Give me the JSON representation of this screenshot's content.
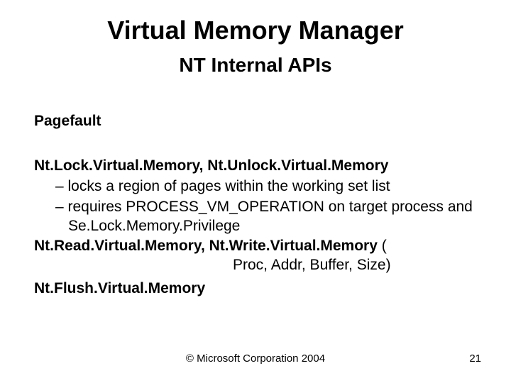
{
  "title": "Virtual Memory Manager",
  "subtitle": "NT Internal APIs",
  "section1": "Pagefault",
  "section2_head": "Nt.Lock.Virtual.Memory, Nt.Unlock.Virtual.Memory",
  "bullet1": "– locks a region of pages within the working set list",
  "bullet2": "– requires PROCESS_VM_OPERATION on target process and Se.Lock.Memory.Privilege",
  "section3_bold": "Nt.Read.Virtual.Memory, Nt.Write.Virtual.Memory",
  "section3_tail": " (",
  "section3_line2": "Proc, Addr, Buffer, Size)",
  "section4": "Nt.Flush.Virtual.Memory",
  "copyright": "© Microsoft Corporation 2004",
  "page_number": "21"
}
